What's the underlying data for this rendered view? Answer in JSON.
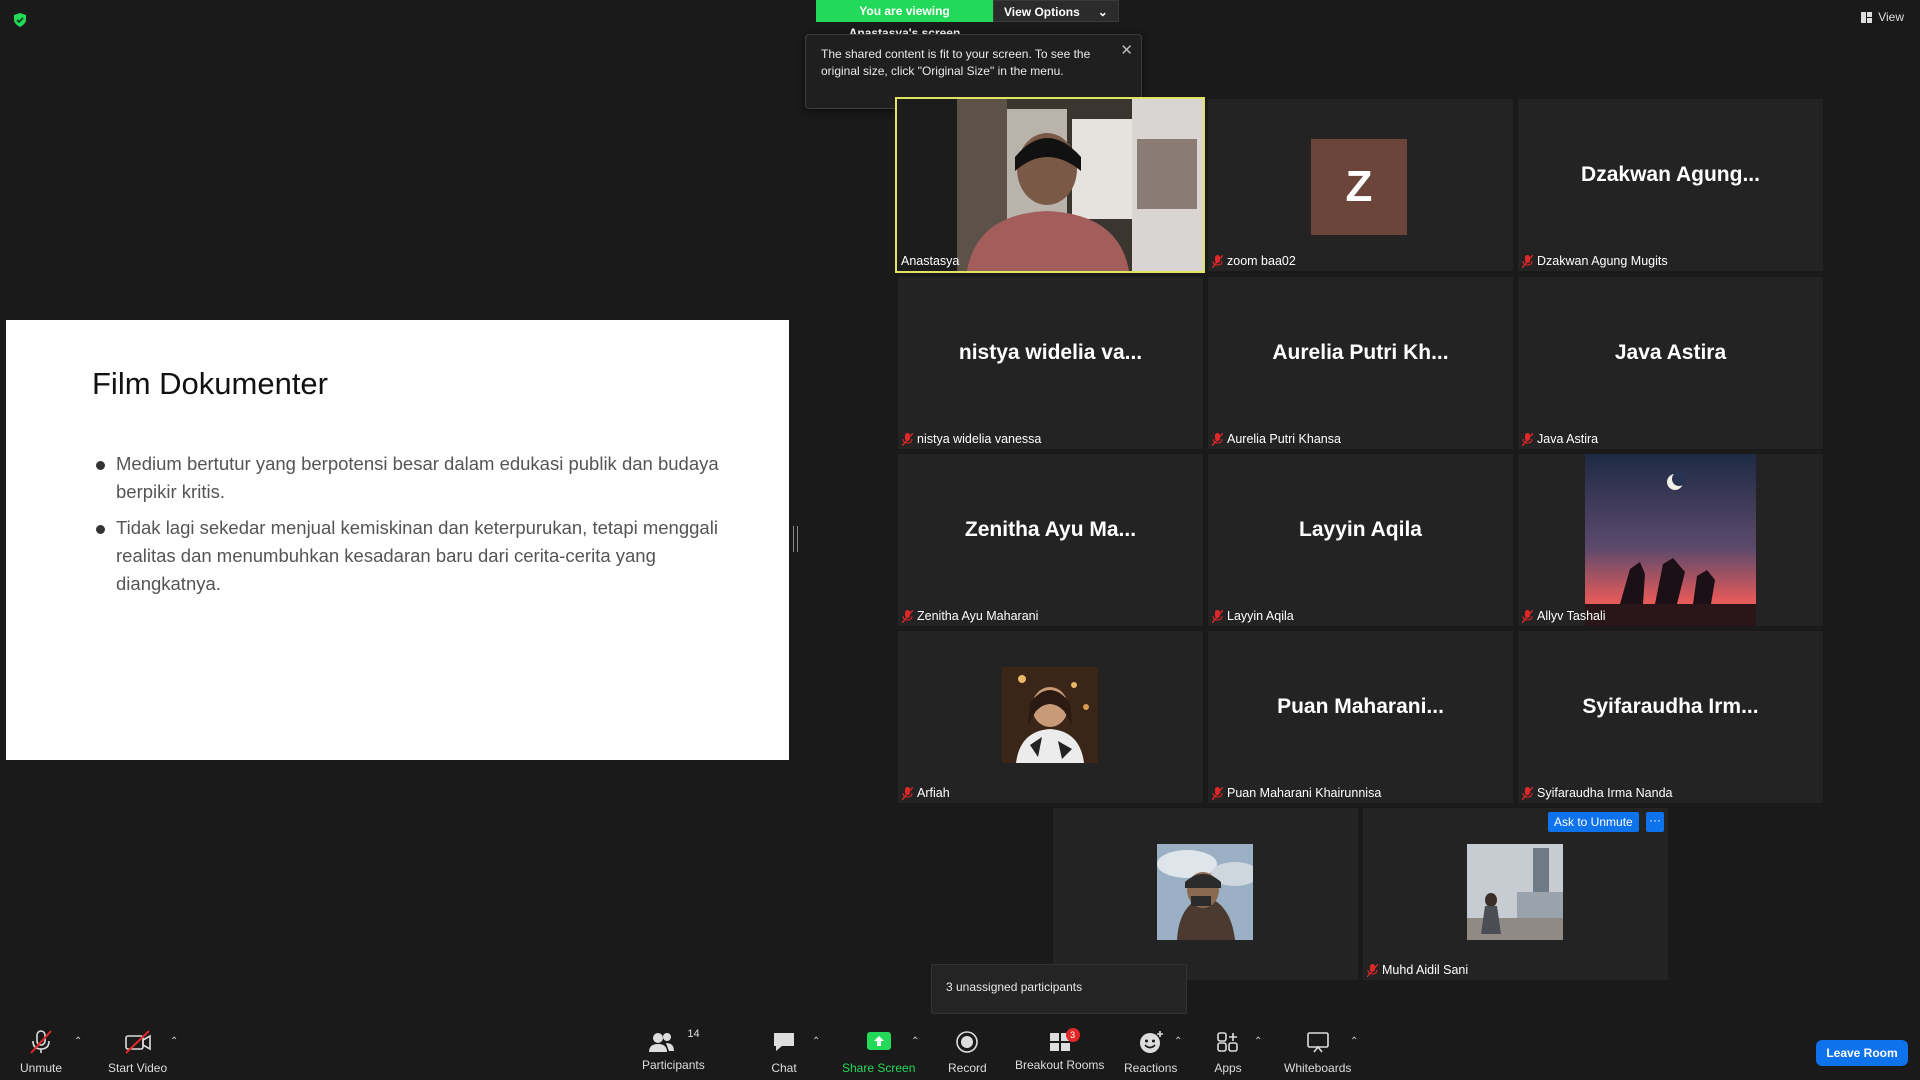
{
  "banner": {
    "viewing": "You are viewing Anastasya's screen",
    "view_options": "View Options"
  },
  "top_right": {
    "view": "View"
  },
  "tooltip": {
    "text": "The shared content is fit to your screen. To see the original size, click \"Original Size\" in the menu."
  },
  "slide": {
    "title": "Film Dokumenter",
    "bullets": [
      "Medium bertutur yang berpotensi besar dalam edukasi publik dan budaya berpikir kritis.",
      "Tidak lagi sekedar menjual kemiskinan dan keterpurukan, tetapi menggali realitas dan menumbuhkan kesadaran baru dari cerita-cerita yang diangkatnya."
    ]
  },
  "tiles": [
    {
      "name": "Anastasya",
      "display": "",
      "type": "video"
    },
    {
      "name": "zoom baa02",
      "display": "Z",
      "type": "avatar-letter"
    },
    {
      "name": "Dzakwan Agung Mugits",
      "display": "Dzakwan  Agung...",
      "type": "text"
    },
    {
      "name": "nistya widelia vanessa",
      "display": "nistya  widelia  va...",
      "type": "text"
    },
    {
      "name": "Aurelia Putri Khansa",
      "display": "Aurelia  Putri  Kh...",
      "type": "text"
    },
    {
      "name": "Java Astira",
      "display": "Java  Astira",
      "type": "text"
    },
    {
      "name": "Zenitha Ayu Maharani",
      "display": "Zenitha  Ayu  Ma...",
      "type": "text"
    },
    {
      "name": "Layyin Aqila",
      "display": "Layyin  Aqila",
      "type": "text"
    },
    {
      "name": "Allyv Tashali",
      "display": "",
      "type": "photo"
    },
    {
      "name": "Arfiah",
      "display": "",
      "type": "photo"
    },
    {
      "name": "Puan Maharani Khairunnisa",
      "display": "Puan  Maharani...",
      "type": "text"
    },
    {
      "name": "Syifaraudha Irma Nanda",
      "display": "Syifaraudha  Irm...",
      "type": "text"
    },
    {
      "name": "",
      "display": "",
      "type": "photo"
    },
    {
      "name": "Muhd Aidil Sani",
      "display": "",
      "type": "photo"
    }
  ],
  "ask_to_unmute": "Ask to Unmute",
  "more": "···",
  "unassigned": "3 unassigned participants",
  "toolbar": {
    "unmute": "Unmute",
    "start_video": "Start Video",
    "participants": "Participants",
    "participants_count": "14",
    "chat": "Chat",
    "share_screen": "Share Screen",
    "record": "Record",
    "breakout_rooms": "Breakout Rooms",
    "breakout_badge": "3",
    "reactions": "Reactions",
    "apps": "Apps",
    "whiteboards": "Whiteboards",
    "leave_room": "Leave Room"
  },
  "colors": {
    "share_green": "#23d959",
    "accent_blue": "#0e72ed",
    "active_speaker": "#dfe561",
    "mic_off_red": "#e02828"
  }
}
